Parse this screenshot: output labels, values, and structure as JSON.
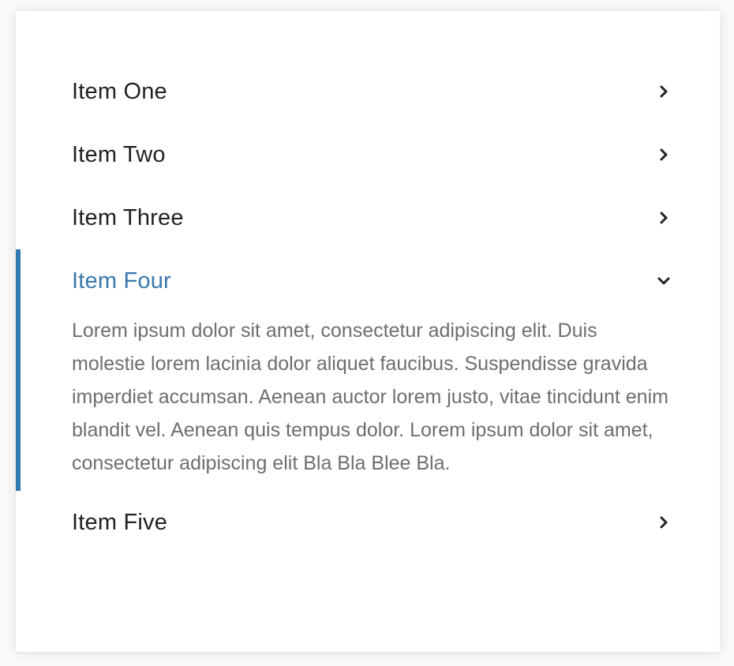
{
  "accordion": {
    "items": [
      {
        "label": "Item One",
        "expanded": false
      },
      {
        "label": "Item Two",
        "expanded": false
      },
      {
        "label": "Item Three",
        "expanded": false
      },
      {
        "label": "Item Four",
        "expanded": true,
        "content": "Lorem ipsum dolor sit amet, consectetur adipiscing elit. Duis molestie lorem lacinia dolor aliquet faucibus. Suspendisse gravida imperdiet accumsan. Aenean auctor lorem justo, vitae tincidunt enim blandit vel. Aenean quis tempus dolor. Lorem ipsum dolor sit amet, consectetur adipiscing elit Bla Bla Blee Bla."
      },
      {
        "label": "Item Five",
        "expanded": false
      }
    ],
    "colors": {
      "accent": "#2f78b0",
      "active_title": "#3a78ad",
      "title": "#222222",
      "body_text": "#6e6e6e"
    },
    "icons": {
      "collapsed": "chevron-right-icon",
      "expanded": "chevron-down-icon"
    }
  }
}
